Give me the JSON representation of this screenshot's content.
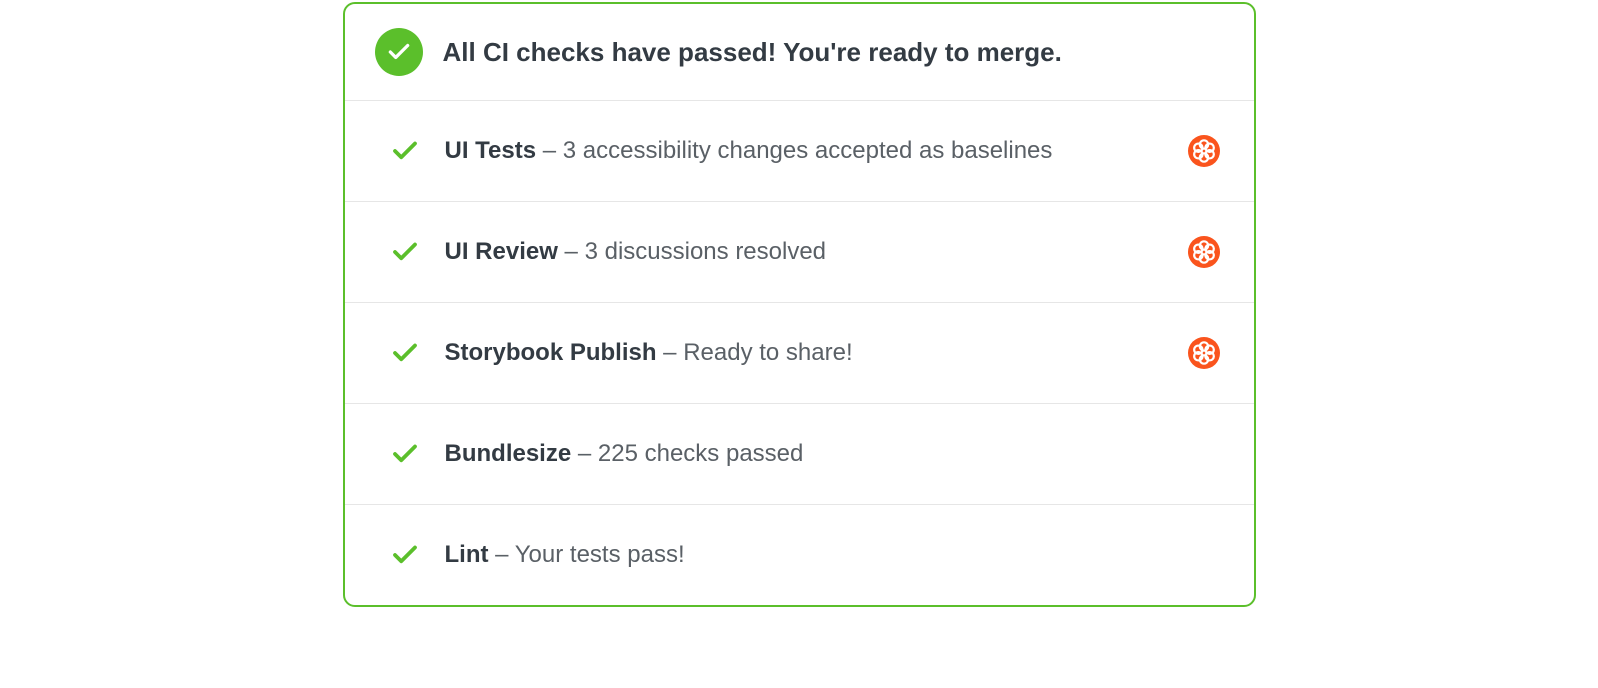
{
  "header": {
    "title": "All CI checks have passed! You're ready to merge."
  },
  "separator": " – ",
  "checks": [
    {
      "title": "UI Tests",
      "detail": "3 accessibility changes accepted as baselines",
      "badge": true
    },
    {
      "title": "UI Review",
      "detail": "3 discussions resolved",
      "badge": true
    },
    {
      "title": "Storybook Publish",
      "detail": "Ready to share!",
      "badge": true
    },
    {
      "title": "Bundlesize",
      "detail": "225 checks passed",
      "badge": false
    },
    {
      "title": "Lint",
      "detail": "Your tests pass!",
      "badge": false
    }
  ],
  "colors": {
    "green": "#5bbf2b",
    "orange": "#fa541d",
    "textDark": "#333b43",
    "textMuted": "#5a6066",
    "divider": "#e6e6e6"
  }
}
